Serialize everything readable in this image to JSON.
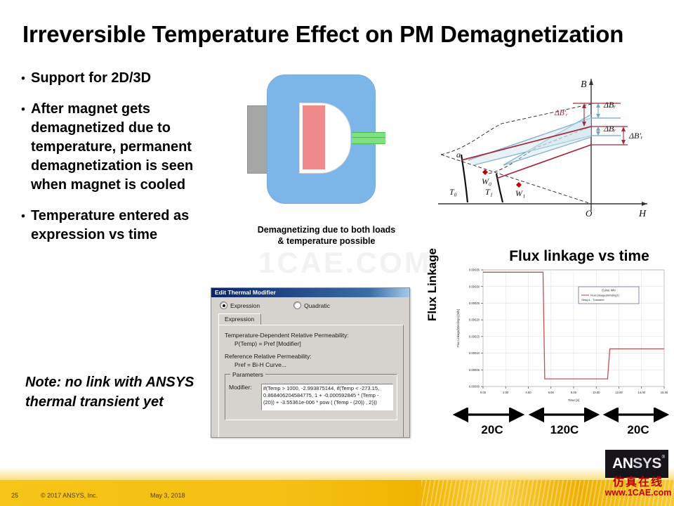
{
  "slide": {
    "title": "Irreversible Temperature Effect on PM Demagnetization",
    "watermark": "1CAE.COM"
  },
  "bullets": [
    {
      "text": "Support for 2D/3D"
    },
    {
      "text": "After magnet gets demagnetized due to temperature, permanent demagnetization is seen when magnet is cooled"
    },
    {
      "text": "Temperature entered as expression vs time"
    }
  ],
  "note": "Note: no link with ANSYS thermal transient yet",
  "magnet_figure": {
    "caption_line1": "Demagnetizing due to both loads",
    "caption_line2": "& temperature possible",
    "parts": {
      "stator_block": "grey-block",
      "core": "blue-core",
      "magnet": "red-magnet",
      "coil": "green-coil"
    }
  },
  "bh_figure": {
    "axis_b": "B",
    "axis_h": "H",
    "origin": "O",
    "point_a": "a",
    "curve_t0": "T0",
    "curve_t1": "T1",
    "work_point_0": "W0",
    "work_point_1": "W1",
    "delta_br_1": "ΔBr",
    "delta_br_2": "ΔBr",
    "delta_br_prime_1": "ΔB'r",
    "delta_br_prime_2": "ΔB'r"
  },
  "thermal_dialog": {
    "title": "Edit Thermal Modifier",
    "radio_expression": "Expression",
    "radio_quadratic": "Quadratic",
    "radio_selected": "Expression",
    "tab_expression": "Expression",
    "line_temp_dep": "Temperature-Dependent Relative Permeability:",
    "line_ptemp": "P(Temp) = Pref [Modifier]",
    "line_ref_perm": "Reference Relative Permeability:",
    "line_pref": "Pref = Bi-H Curve...",
    "parameters_legend": "Parameters",
    "modifier_label": "Modifier:",
    "modifier_value": "if(Temp > 1000, -2.993875144, if(Temp < -273.15, 0.868406204584775, 1 + -0.000592845 * (Temp - (20)) + -3.55361e-006 * pow ( (Temp - (20)) , 2)))"
  },
  "flux_chart": {
    "title": "Flux linkage vs time",
    "ylabel_big": "Flux Linkage",
    "temperature_bands": [
      {
        "label": "20C"
      },
      {
        "label": "120C"
      },
      {
        "label": "20C"
      }
    ]
  },
  "chart_data": {
    "type": "line",
    "title": "Flux linkage vs time",
    "xlabel": "Time [s]",
    "ylabel": "Flux Linkage(Winding1) [Wb]",
    "xlim": [
      0,
      16
    ],
    "ylim": [
      0.0,
      0.00035
    ],
    "xticks": [
      "0.00",
      "2.00",
      "4.00",
      "6.00",
      "8.00",
      "10.00",
      "12.00",
      "14.00",
      "16.00"
    ],
    "yticks": [
      "0.00000",
      "0.00005",
      "0.00010",
      "0.00015",
      "0.00020",
      "0.00025",
      "0.00030",
      "0.00035"
    ],
    "grid": true,
    "legend_position": "upper-right-inside",
    "legend": {
      "header": "Curve Info",
      "series_label": "FluxLinkage(Winding1)",
      "setup_label": "Setup1 : Transient"
    },
    "series": [
      {
        "name": "FluxLinkage(Winding1)",
        "color": "#c0504d",
        "x": [
          0.0,
          5.3,
          5.45,
          11.0,
          11.2,
          16.0
        ],
        "y": [
          0.000343,
          0.000343,
          2.3e-05,
          2.3e-05,
          0.000113,
          0.000113
        ]
      }
    ],
    "annotations": [
      {
        "label": "20C",
        "x_start": 0.0,
        "x_end": 5.3
      },
      {
        "label": "120C",
        "x_start": 5.6,
        "x_end": 11.0
      },
      {
        "label": "20C",
        "x_start": 11.3,
        "x_end": 16.0
      }
    ]
  },
  "footer": {
    "page_number": "25",
    "copyright": "© 2017 ANSYS, Inc.",
    "date": "May 3, 2018",
    "logo_text": "ANSYS",
    "logo_registered": "®",
    "watermark_cn": "仿真在线",
    "watermark_url": "www.1CAE.com"
  },
  "colors": {
    "accent_gold": "#f5c518",
    "curve_red": "#c0504d",
    "core_blue": "#7cb5e8",
    "magnet_red": "#f08a8a",
    "coil_green": "#7ee07e",
    "titlebar_blue": "#0a246a"
  }
}
